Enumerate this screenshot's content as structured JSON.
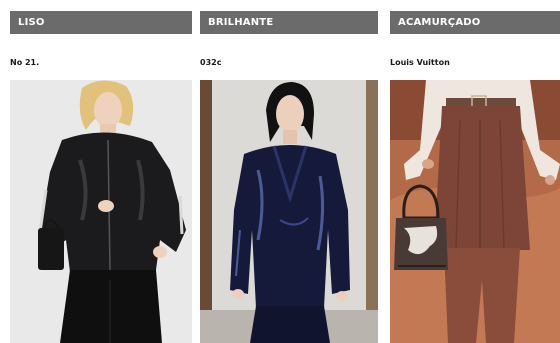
{
  "columns": [
    {
      "category": "LISO",
      "brand": "No 21."
    },
    {
      "category": "BRILHANTE",
      "brand": "032c"
    },
    {
      "category": "ACAMURÇADO",
      "brand": "Louis Vuitton"
    }
  ],
  "colors": {
    "header_bg": "#6b6b6b",
    "header_text": "#ffffff"
  }
}
